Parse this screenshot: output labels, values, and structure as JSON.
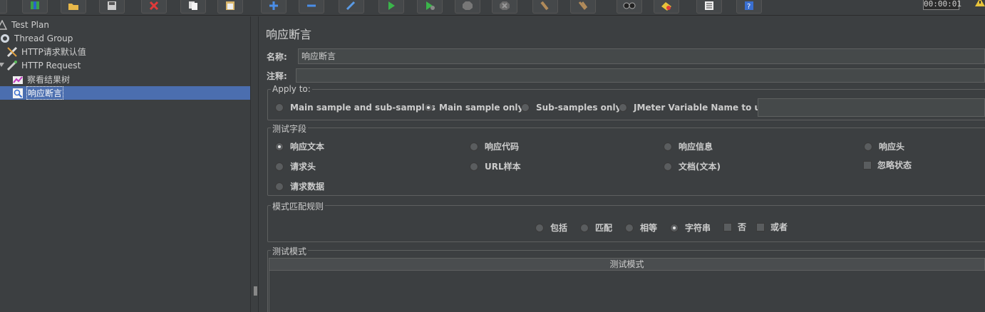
{
  "toolbar": {
    "buttons": [
      "new-icon",
      "templates-icon",
      "open-icon",
      "save-icon",
      "cut-icon",
      "copy-icon",
      "paste-icon",
      "expand-icon",
      "collapse-icon",
      "toggle-icon",
      "start-icon",
      "start-no-pause-icon",
      "stop-icon",
      "shutdown-icon",
      "clear-icon",
      "clear-all-icon",
      "search-icon",
      "reset-search-icon",
      "function-helper-icon",
      "help-icon"
    ],
    "timer": "00:00:01"
  },
  "tree": {
    "items": [
      {
        "label": "Test Plan",
        "icon": "test-plan-icon"
      },
      {
        "label": "Thread Group",
        "icon": "gear-icon"
      },
      {
        "label": "HTTP请求默认值",
        "icon": "wrench-icon"
      },
      {
        "label": "HTTP Request",
        "icon": "pipette-icon"
      },
      {
        "label": "察看结果树",
        "icon": "chart-icon"
      },
      {
        "label": "响应断言",
        "icon": "assertion-icon"
      }
    ]
  },
  "panel": {
    "title": "响应断言",
    "name_label": "名称:",
    "name_value": "响应断言",
    "comment_label": "注释:",
    "comment_value": "",
    "apply_to": {
      "legend": "Apply to:",
      "options": [
        "Main sample and sub-samples",
        "Main sample only",
        "Sub-samples only",
        "JMeter Variable Name to use"
      ],
      "selected": "Main sample only",
      "variable_value": ""
    },
    "test_field": {
      "legend": "测试字段",
      "options": [
        "响应文本",
        "响应代码",
        "响应信息",
        "响应头",
        "请求头",
        "URL样本",
        "文档(文本)",
        "请求数据"
      ],
      "selected": "响应文本",
      "ignore_status": "忽略状态"
    },
    "pattern_rules": {
      "legend": "模式匹配规则",
      "options": [
        "包括",
        "匹配",
        "相等",
        "字符串"
      ],
      "selected": "字符串",
      "not_label": "否",
      "or_label": "或者"
    },
    "test_patterns": {
      "legend": "测试模式",
      "column": "测试模式"
    }
  },
  "colors": {
    "selection": "#4b6eaf",
    "background": "#3c3f41",
    "field": "#45494a"
  }
}
